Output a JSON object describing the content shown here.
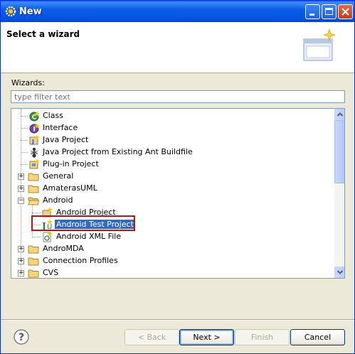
{
  "window": {
    "title": "New"
  },
  "banner": {
    "title": "Select a wizard"
  },
  "wizards_label": "Wizards:",
  "filter": {
    "placeholder": "type filter text",
    "value": ""
  },
  "tree": [
    {
      "label": "Class",
      "icon": "class-icon",
      "level": 1
    },
    {
      "label": "Interface",
      "icon": "interface-icon",
      "level": 1
    },
    {
      "label": "Java Project",
      "icon": "java-project-icon",
      "level": 1
    },
    {
      "label": "Java Project from Existing Ant Buildfile",
      "icon": "ant-icon",
      "level": 1
    },
    {
      "label": "Plug-in Project",
      "icon": "plugin-project-icon",
      "level": 1
    },
    {
      "label": "General",
      "icon": "folder-icon",
      "level": 0,
      "expanded": false
    },
    {
      "label": "AmaterasUML",
      "icon": "folder-icon",
      "level": 0,
      "expanded": false
    },
    {
      "label": "Android",
      "icon": "folder-open-icon",
      "level": 0,
      "expanded": true
    },
    {
      "label": "Android Project",
      "icon": "android-project-icon",
      "level": 1
    },
    {
      "label": "Android Test Project",
      "icon": "android-test-project-icon",
      "level": 1,
      "selected": true
    },
    {
      "label": "Android XML File",
      "icon": "android-xml-icon",
      "level": 1
    },
    {
      "label": "AndroMDA",
      "icon": "folder-icon",
      "level": 0,
      "expanded": false
    },
    {
      "label": "Connection Profiles",
      "icon": "folder-icon",
      "level": 0,
      "expanded": false
    },
    {
      "label": "CVS",
      "icon": "folder-icon",
      "level": 0,
      "expanded": false
    }
  ],
  "buttons": {
    "back": "< Back",
    "next": "Next >",
    "finish": "Finish",
    "cancel": "Cancel"
  },
  "help_glyph": "?",
  "colors": {
    "titlebar": "#0a5ee8",
    "selection": "#316ac5",
    "highlight_box": "#b01818"
  }
}
